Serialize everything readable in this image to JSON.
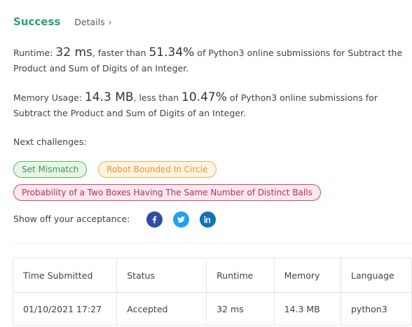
{
  "header": {
    "status": "Success",
    "details_label": "Details",
    "details_chevron": "›"
  },
  "runtime": {
    "label": "Runtime:",
    "value": "32 ms",
    "comparison": ", faster than",
    "percent": "51.34%",
    "suffix": "of Python3 online submissions for Subtract the Product and Sum of Digits of an Integer."
  },
  "memory": {
    "label": "Memory Usage:",
    "value": "14.3 MB",
    "comparison": ", less than",
    "percent": "10.47%",
    "suffix": "of Python3 online submissions for Subtract the Product and Sum of Digits of an Integer."
  },
  "next_challenges": {
    "label": "Next challenges:",
    "items": [
      {
        "title": "Set Mismatch",
        "difficulty": "easy"
      },
      {
        "title": "Robot Bounded In Circle",
        "difficulty": "medium"
      },
      {
        "title": "Probability of a Two Boxes Having The Same Number of Distinct Balls",
        "difficulty": "hard"
      }
    ]
  },
  "share": {
    "label": "Show off your acceptance:",
    "icons": [
      "facebook-icon",
      "twitter-icon",
      "linkedin-icon"
    ]
  },
  "submissions_table": {
    "headers": [
      "Time Submitted",
      "Status",
      "Runtime",
      "Memory",
      "Language"
    ],
    "rows": [
      [
        "01/10/2021 17:27",
        "Accepted",
        "32 ms",
        "14.3 MB",
        "python3"
      ]
    ]
  },
  "colors": {
    "success": "#2e9c7a",
    "easy": "#5cb85c",
    "medium": "#f0ad4e",
    "hard": "#d94177"
  }
}
